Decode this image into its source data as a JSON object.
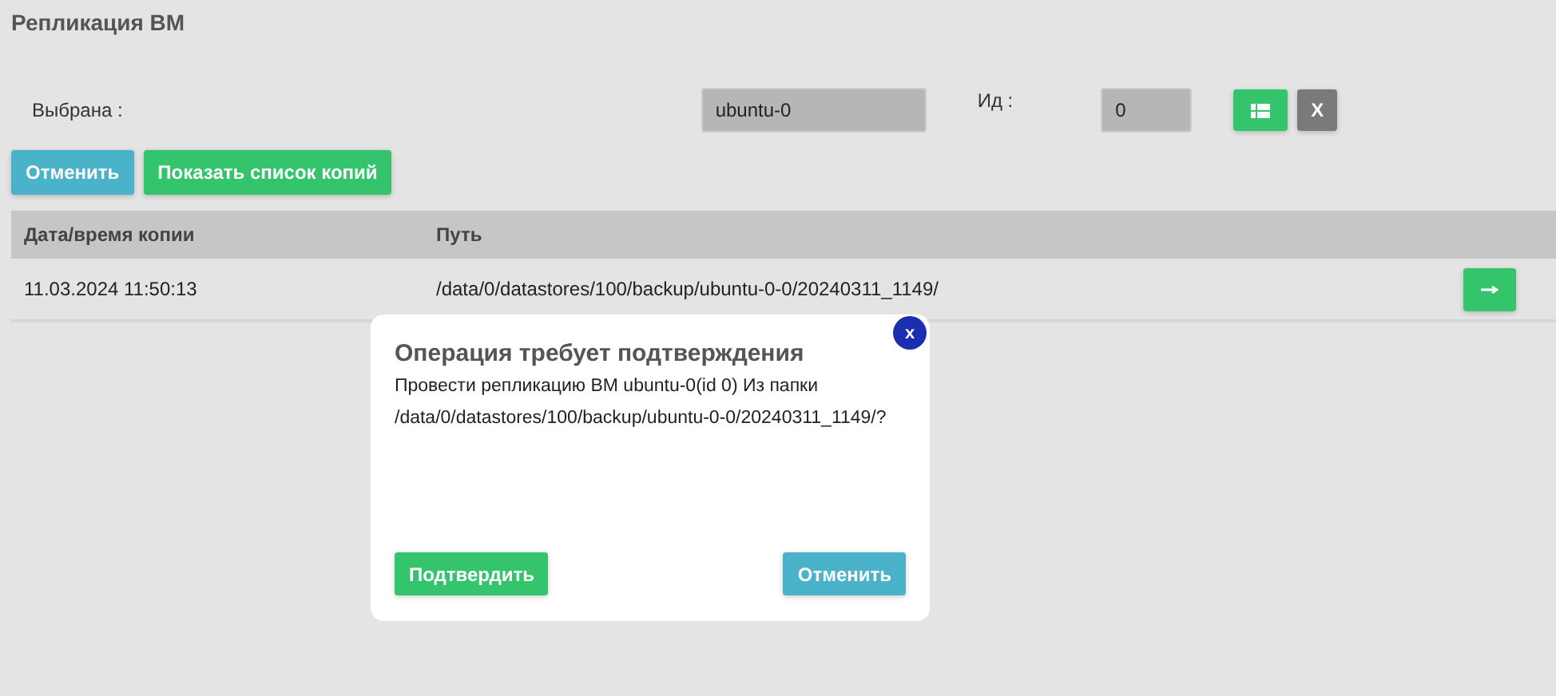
{
  "title": "Репликация ВМ",
  "selection": {
    "label": "Выбрана :",
    "value": "ubuntu-0",
    "id_label": "Ид :",
    "id_value": "0",
    "clear_button": "X"
  },
  "actions": [
    {
      "label": "Отменить",
      "kind": "info"
    },
    {
      "label": "Показать список копий",
      "kind": "success"
    }
  ],
  "table": {
    "columns": [
      "Дата/время копии",
      "Путь"
    ],
    "rows": [
      {
        "cells": [
          "11.03.2024 11:50:13",
          "/data/0/datastores/100/backup/ubuntu-0-0/20240311_1149/"
        ]
      }
    ]
  },
  "dialog": {
    "title": "Операция требует подтверждения",
    "message": "Провести репликацию ВМ ubuntu-0(id 0) Из папки /data/0/datastores/100/backup/ubuntu-0-0/20240311_1149/?",
    "close": "x",
    "buttons": [
      {
        "label": "Подтвердить",
        "kind": "success"
      },
      {
        "label": "Отменить",
        "kind": "info"
      }
    ]
  }
}
